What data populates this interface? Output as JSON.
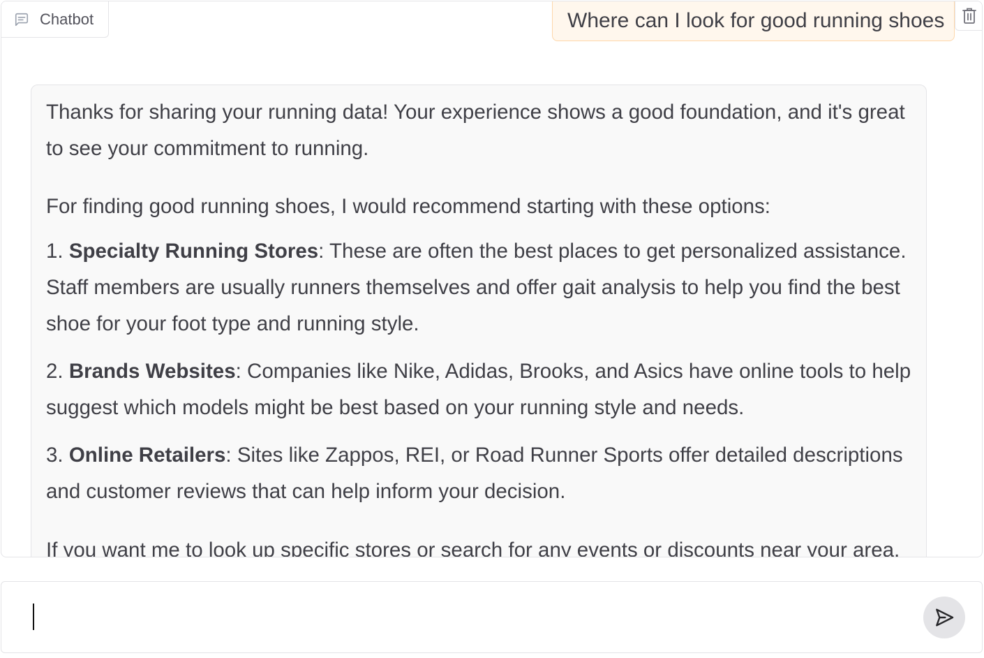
{
  "chatbot": {
    "label": "Chatbot",
    "label_icon": "chat-bubble-icon",
    "clear_icon": "trash-icon"
  },
  "messages": {
    "user": "Where can I look for good running shoes",
    "bot": {
      "para1": "Thanks for sharing your running data! Your experience shows a good foundation, and it's great to see your commitment to running.",
      "intro": "For finding good running shoes, I would recommend starting with these options:",
      "items": [
        {
          "num": "1. ",
          "title": "Specialty Running Stores",
          "text": ": These are often the best places to get personalized assistance. Staff members are usually runners themselves and offer gait analysis to help you find the best shoe for your foot type and running style."
        },
        {
          "num": "2. ",
          "title": "Brands Websites",
          "text": ": Companies like Nike, Adidas, Brooks, and Asics have online tools to help suggest which models might be best based on your running style and needs."
        },
        {
          "num": "3. ",
          "title": "Online Retailers",
          "text": ": Sites like Zappos, REI, or Road Runner Sports offer detailed descriptions and customer reviews that can help inform your decision."
        }
      ],
      "closing": "If you want me to look up specific stores or search for any events or discounts near your area,"
    }
  },
  "input": {
    "value": "",
    "placeholder": "",
    "submit_icon": "send-icon"
  },
  "colors": {
    "user_bubble_bg": "#fff7ed",
    "user_bubble_border": "#fed7aa",
    "bot_bubble_bg": "#f9f9f9",
    "border": "#e4e4e7",
    "text": "#3f3f46"
  }
}
